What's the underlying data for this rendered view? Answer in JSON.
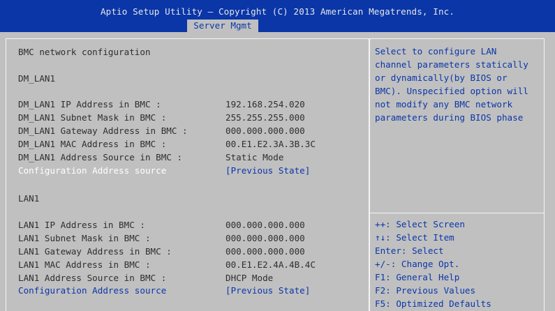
{
  "header": {
    "title": "Aptio Setup Utility – Copyright (C) 2013 American Megatrends, Inc.",
    "active_tab": "Server Mgmt"
  },
  "main": {
    "heading": "BMC network configuration",
    "dm_lan1": {
      "section": "DM_LAN1",
      "ip_label": "DM_LAN1 IP Address in BMC :",
      "ip_value": "192.168.254.020",
      "subnet_label": "DM_LAN1 Subnet Mask in BMC :",
      "subnet_value": "255.255.255.000",
      "gateway_label": "DM_LAN1 Gateway Address in BMC :",
      "gateway_value": "000.000.000.000",
      "mac_label": "DM_LAN1 MAC Address in BMC :",
      "mac_value": "00.E1.E2.3A.3B.3C",
      "source_label": "DM_LAN1 Address Source in BMC :",
      "source_value": "Static Mode",
      "config_label": "Configuration Address source",
      "config_value": "[Previous State]"
    },
    "lan1": {
      "section": "LAN1",
      "ip_label": "LAN1 IP Address in BMC :",
      "ip_value": "000.000.000.000",
      "subnet_label": "LAN1 Subnet Mask in BMC :",
      "subnet_value": "000.000.000.000",
      "gateway_label": "LAN1 Gateway Address in BMC :",
      "gateway_value": "000.000.000.000",
      "mac_label": "LAN1 MAC Address in BMC :",
      "mac_value": "00.E1.E2.4A.4B.4C",
      "source_label": "LAN1 Address Source in BMC :",
      "source_value": "DHCP Mode",
      "config_label": "Configuration Address source",
      "config_value": "[Previous State]"
    }
  },
  "help": {
    "lines": [
      "Select to configure LAN",
      "channel parameters statically",
      "or dynamically(by BIOS or",
      "BMC). Unspecified option will",
      "not modify any BMC network",
      "parameters during BIOS phase"
    ]
  },
  "keys": {
    "select_screen": "++: Select Screen",
    "select_item": "↑↓: Select Item",
    "enter": "Enter: Select",
    "change": "+/-: Change Opt.",
    "f1": "F1: General Help",
    "f2": "F2: Previous Values",
    "f5": "F5: Optimized Defaults"
  },
  "colors": {
    "header_bg": "#0a36a8",
    "body_bg": "#c0c0c0",
    "highlight_text": "#ffffff",
    "help_text": "#0a36a8"
  }
}
